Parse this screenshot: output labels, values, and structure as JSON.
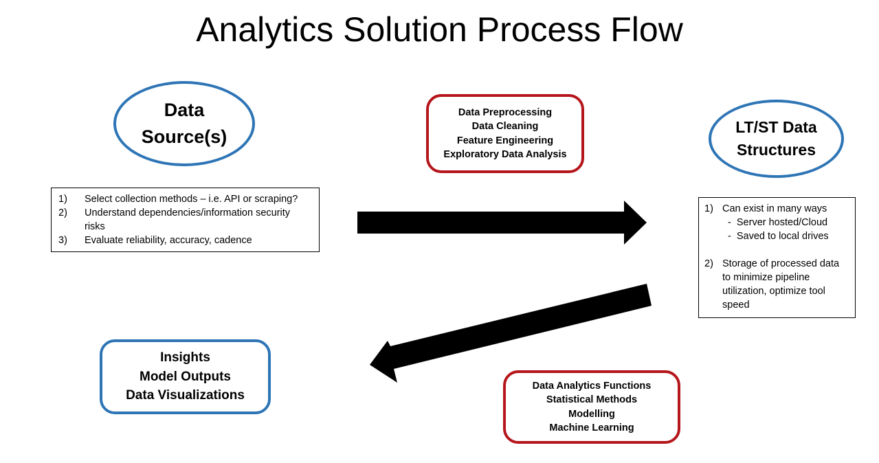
{
  "title": "Analytics Solution Process Flow",
  "data_sources": {
    "lines": [
      "Data",
      "Source(s)"
    ],
    "notes": [
      {
        "num": "1)",
        "text": "Select collection methods – i.e. API or scraping?"
      },
      {
        "num": "2)",
        "text": "Understand dependencies/information security risks"
      },
      {
        "num": "3)",
        "text": "Evaluate reliability, accuracy, cadence"
      }
    ]
  },
  "preprocessing": {
    "lines": [
      "Data Preprocessing",
      "Data Cleaning",
      "Feature Engineering",
      "Exploratory Data Analysis"
    ]
  },
  "structures": {
    "lines": [
      "LT/ST Data",
      "Structures"
    ],
    "notes": {
      "item1_num": "1)",
      "item1_text": "Can exist in many ways",
      "item1_sub1": "-  Server hosted/Cloud",
      "item1_sub2": "-  Saved to local drives",
      "item2_num": "2)",
      "item2_text": "Storage of processed data to minimize pipeline utilization, optimize tool speed"
    }
  },
  "analytics": {
    "lines": [
      "Data Analytics Functions",
      "Statistical Methods",
      "Modelling",
      "Machine Learning"
    ]
  },
  "insights": {
    "lines": [
      "Insights",
      "Model Outputs",
      "Data Visualizations"
    ]
  },
  "colors": {
    "blue_outline": "#2e75b6",
    "red_outline": "#b4161b",
    "arrow": "#000000"
  }
}
